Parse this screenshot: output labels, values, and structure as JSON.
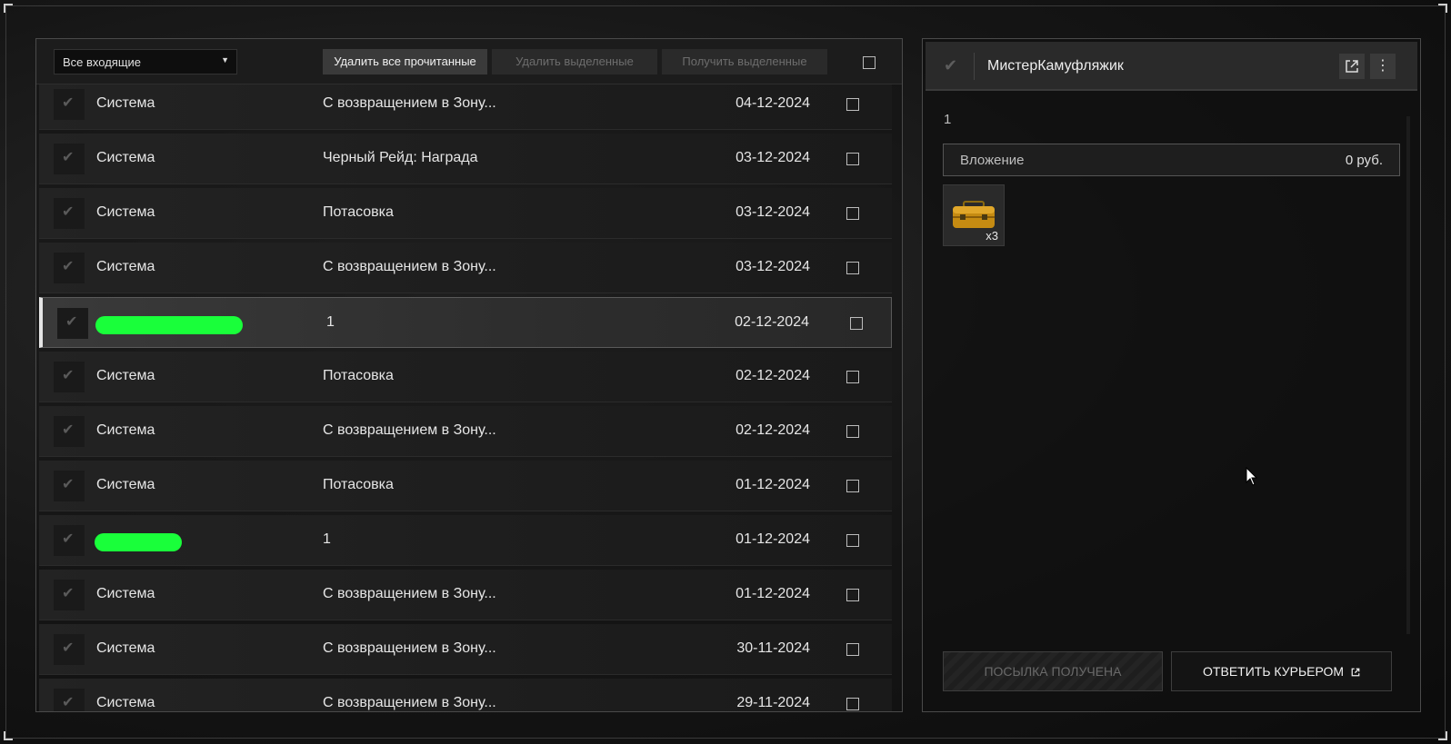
{
  "toolbar": {
    "filter_value": "Все входящие",
    "delete_read_label": "Удалить все прочитанные",
    "delete_selected_label": "Удалить выделенные",
    "receive_selected_label": "Получить выделенные"
  },
  "messages": [
    {
      "sender": "Система",
      "subject": "С возвращением в Зону...",
      "date": "04-12-2024"
    },
    {
      "sender": "Система",
      "subject": "Черный Рейд: Награда",
      "date": "03-12-2024"
    },
    {
      "sender": "Система",
      "subject": "Потасовка",
      "date": "03-12-2024"
    },
    {
      "sender": "Система",
      "subject": "С возвращением в Зону...",
      "date": "03-12-2024"
    },
    {
      "sender": "",
      "subject": "1",
      "date": "02-12-2024",
      "redacted": true
    },
    {
      "sender": "Система",
      "subject": "Потасовка",
      "date": "02-12-2024"
    },
    {
      "sender": "Система",
      "subject": "С возвращением в Зону...",
      "date": "02-12-2024"
    },
    {
      "sender": "Система",
      "subject": "Потасовка",
      "date": "01-12-2024"
    },
    {
      "sender": "",
      "subject": "1",
      "date": "01-12-2024",
      "redacted": true
    },
    {
      "sender": "Система",
      "subject": "С возвращением в Зону...",
      "date": "01-12-2024"
    },
    {
      "sender": "Система",
      "subject": "С возвращением в Зону...",
      "date": "30-11-2024"
    },
    {
      "sender": "Система",
      "subject": "С возвращением в Зону...",
      "date": "29-11-2024"
    }
  ],
  "detail": {
    "sender": "МистерКамуфляжик",
    "body": "1",
    "attachment_label": "Вложение",
    "attachment_value": "0 руб.",
    "item_count": "x3",
    "received_label": "ПОСЫЛКА ПОЛУЧЕНА",
    "reply_label": "ОТВЕТИТЬ КУРЬЕРОМ"
  },
  "colors": {
    "redaction": "#19ff3a",
    "accent": "#e6e6e6"
  }
}
